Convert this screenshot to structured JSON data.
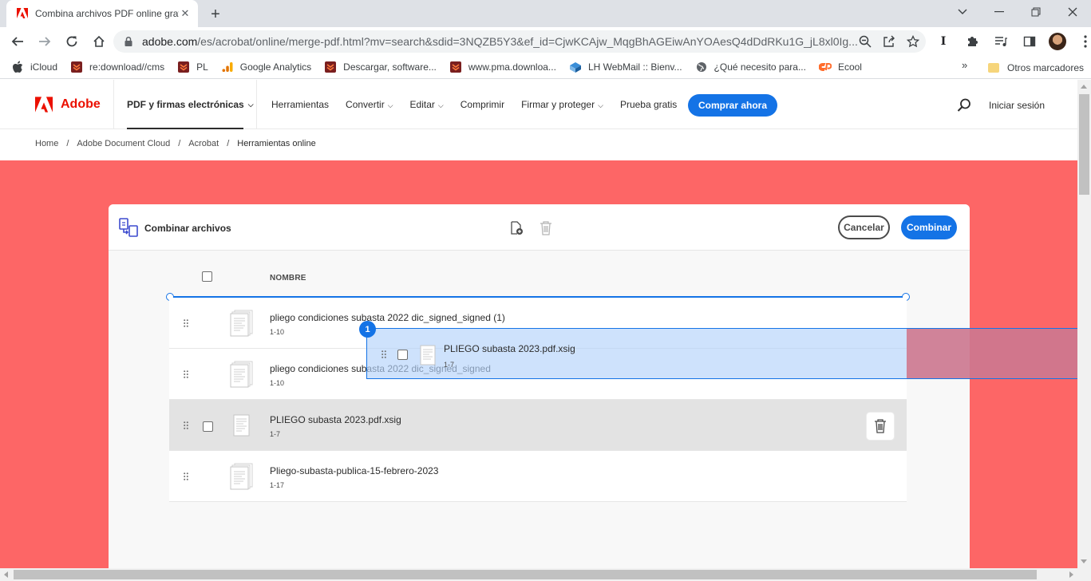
{
  "browser": {
    "tab_title": "Combina archivos PDF online gratis",
    "new_tab": "+",
    "url_host": "adobe.com",
    "url_path": "/es/acrobat/online/merge-pdf.html?mv=search&sdid=3NQZB5Y3&ef_id=CjwKCAjw_MqgBhAGEiwAnYOAesQ4dDdRKu1G_jL8xl0Ig...",
    "bookmarks": [
      {
        "label": "iCloud",
        "icon": "apple-icon"
      },
      {
        "label": "re:download//cms",
        "icon": "download-icon"
      },
      {
        "label": "PL",
        "icon": "download-icon"
      },
      {
        "label": "Google Analytics",
        "icon": "analytics-icon"
      },
      {
        "label": "Descargar, software...",
        "icon": "download-icon"
      },
      {
        "label": "www.pma.downloa...",
        "icon": "download-icon"
      },
      {
        "label": "LH WebMail :: Bienv...",
        "icon": "webmail-icon"
      },
      {
        "label": "¿Qué necesito para...",
        "icon": "globe-icon"
      },
      {
        "label": "Ecool",
        "icon": "cpanel-icon"
      }
    ],
    "bookmarks_more": "»",
    "other_bookmarks": "Otros marcadores"
  },
  "nav": {
    "brand": "Adobe",
    "primary": "PDF y firmas electrónicas",
    "links": [
      {
        "label": "Herramientas",
        "dropdown": false
      },
      {
        "label": "Convertir",
        "dropdown": true
      },
      {
        "label": "Editar",
        "dropdown": true
      },
      {
        "label": "Comprimir",
        "dropdown": false
      },
      {
        "label": "Firmar y proteger",
        "dropdown": true
      },
      {
        "label": "Prueba gratis",
        "dropdown": false
      }
    ],
    "cta": "Comprar ahora",
    "signin": "Iniciar sesión"
  },
  "breadcrumb": [
    "Home",
    "Adobe Document Cloud",
    "Acrobat",
    "Herramientas online"
  ],
  "tool": {
    "title": "Combinar archivos",
    "cancel": "Cancelar",
    "combine": "Combinar",
    "column_name": "NOMBRE",
    "files": [
      {
        "name": "pliego condiciones subasta 2022 dic_signed_signed (1)",
        "pages": "1-10",
        "selected": false
      },
      {
        "name": "pliego condiciones subasta 2022 dic_signed_signed",
        "pages": "1-10",
        "selected": false
      },
      {
        "name": "PLIEGO subasta 2023.pdf.xsig",
        "pages": "1-7",
        "selected": true
      },
      {
        "name": "Pliego-subasta-publica-15-febrero-2023",
        "pages": "1-17",
        "selected": false
      }
    ],
    "drag": {
      "badge": "1",
      "name": "PLIEGO subasta 2023.pdf.xsig",
      "pages": "1-7"
    }
  },
  "colors": {
    "accent": "#1473e6",
    "brand": "#eb1000",
    "hero": "#fd6666"
  }
}
